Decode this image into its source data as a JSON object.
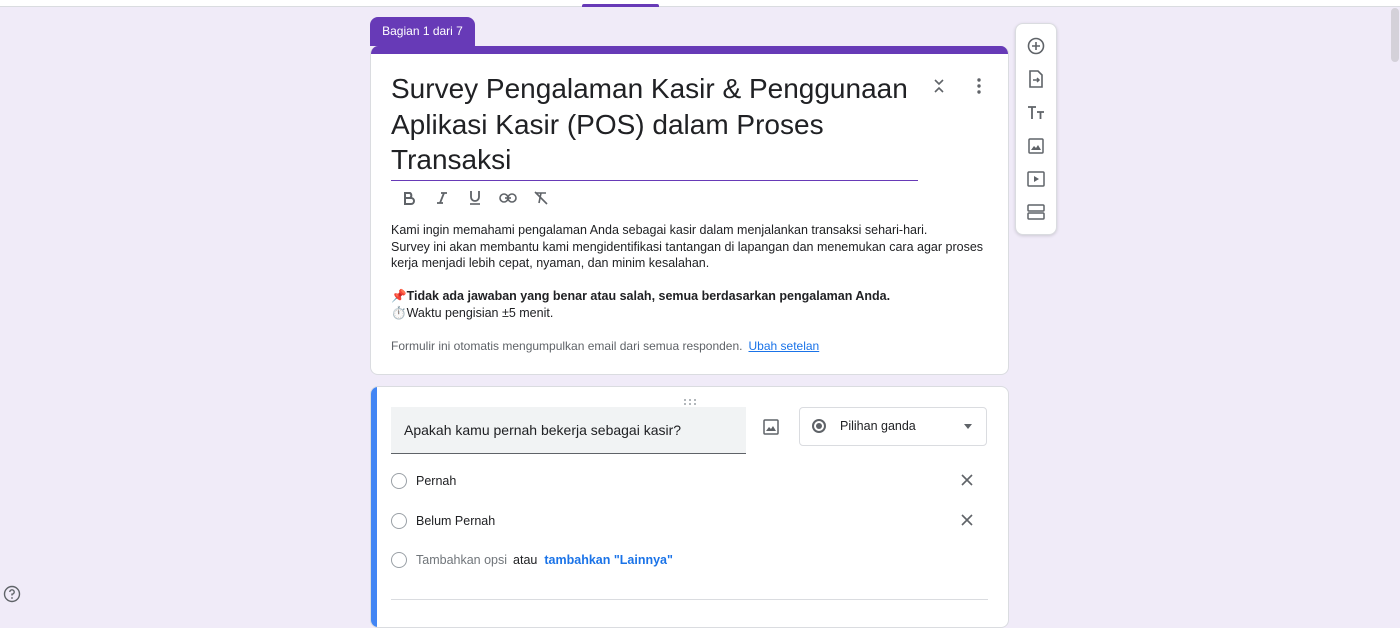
{
  "section_tab": {
    "label": "Bagian 1 dari 7"
  },
  "form_header": {
    "title": "Survey Pengalaman Kasir & Penggunaan Aplikasi Kasir (POS) dalam Proses Transaksi",
    "description_lines": [
      "Kami ingin memahami pengalaman Anda sebagai kasir dalam menjalankan transaksi sehari-hari.",
      "Survey ini akan membantu kami mengidentifikasi tantangan di lapangan dan menemukan cara agar proses kerja menjadi lebih cepat, nyaman, dan minim kesalahan."
    ],
    "note_bold": "📌Tidak ada jawaban yang benar atau salah, semua berdasarkan pengalaman Anda.",
    "note_time": "⏱️Waktu pengisian ±5 menit.",
    "email_notice": "Formulir ini otomatis mengumpulkan email dari semua responden.",
    "email_settings_link": "Ubah setelan"
  },
  "format_toolbar": {
    "icons": [
      "bold-icon",
      "italic-icon",
      "underline-icon",
      "link-icon",
      "clear-format-icon"
    ]
  },
  "side_toolbar": {
    "icons": [
      "add-question-icon",
      "import-questions-icon",
      "add-title-icon",
      "add-image-icon",
      "add-video-icon",
      "add-section-icon"
    ]
  },
  "question": {
    "text": "Apakah kamu pernah bekerja sebagai kasir?",
    "type": "Pilihan ganda",
    "options": [
      "Pernah",
      "Belum Pernah"
    ],
    "add_option": "Tambahkan opsi",
    "or_text": "atau",
    "add_other": "tambahkan \"Lainnya\""
  },
  "colors": {
    "theme": "#673ab7",
    "background": "#f0ebf8",
    "active_accent": "#4285f4",
    "link": "#1a73e8"
  }
}
